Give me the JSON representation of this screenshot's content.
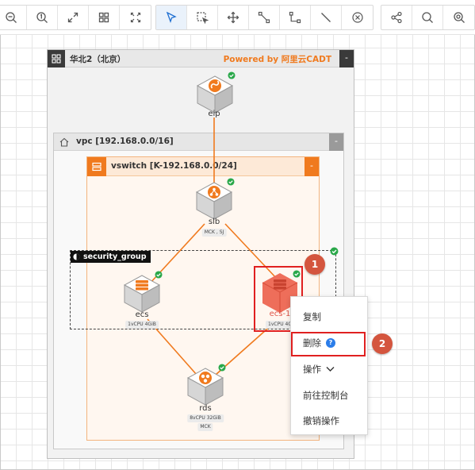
{
  "toolbar": {
    "groups": [
      [
        "zoom-out-icon",
        "zoom-1-to-1-icon",
        "zoom-fit-icon",
        "layout-grid-icon",
        "fullscreen-icon"
      ],
      [
        "select-pointer-icon",
        "box-select-icon",
        "pan-move-icon",
        "connect-line-icon",
        "orthogonal-line-icon",
        "straight-line-icon",
        "clear-icon"
      ],
      [
        "share-icon",
        "search-icon",
        "find-node-icon"
      ]
    ],
    "active_tool": "select-pointer-icon"
  },
  "region": {
    "title": "华北2（北京）",
    "brand": "Powered by 阿里云CADT",
    "collapse": "-"
  },
  "vpc": {
    "title": "vpc [192.168.0.0/16]",
    "collapse": "-"
  },
  "vswitch": {
    "title": "vswitch [K-192.168.0.0/24]",
    "collapse": "-"
  },
  "security_group": {
    "label": "security_group"
  },
  "nodes": {
    "eip": {
      "label": "eip"
    },
    "slb": {
      "label": "slb",
      "spec": "MCK , SJ"
    },
    "ecs": {
      "label": "ecs",
      "spec": "1vCPU 4GiB"
    },
    "ecs1": {
      "label": "ecs-1",
      "spec": "1vCPU 4G"
    },
    "rds": {
      "label": "rds",
      "spec": "8vCPU 32GiB",
      "spec2": "MCK"
    }
  },
  "badges": {
    "step1": "1",
    "step2": "2"
  },
  "context_menu": {
    "copy": "复制",
    "delete": "删除",
    "actions": "操作",
    "console": "前往控制台",
    "undo": "撤销操作"
  },
  "colors": {
    "accent": "#f07a1e",
    "selected": "#e0574a",
    "highlight": "#e02020",
    "ok": "#2aa84a",
    "help": "#2b7de9"
  }
}
